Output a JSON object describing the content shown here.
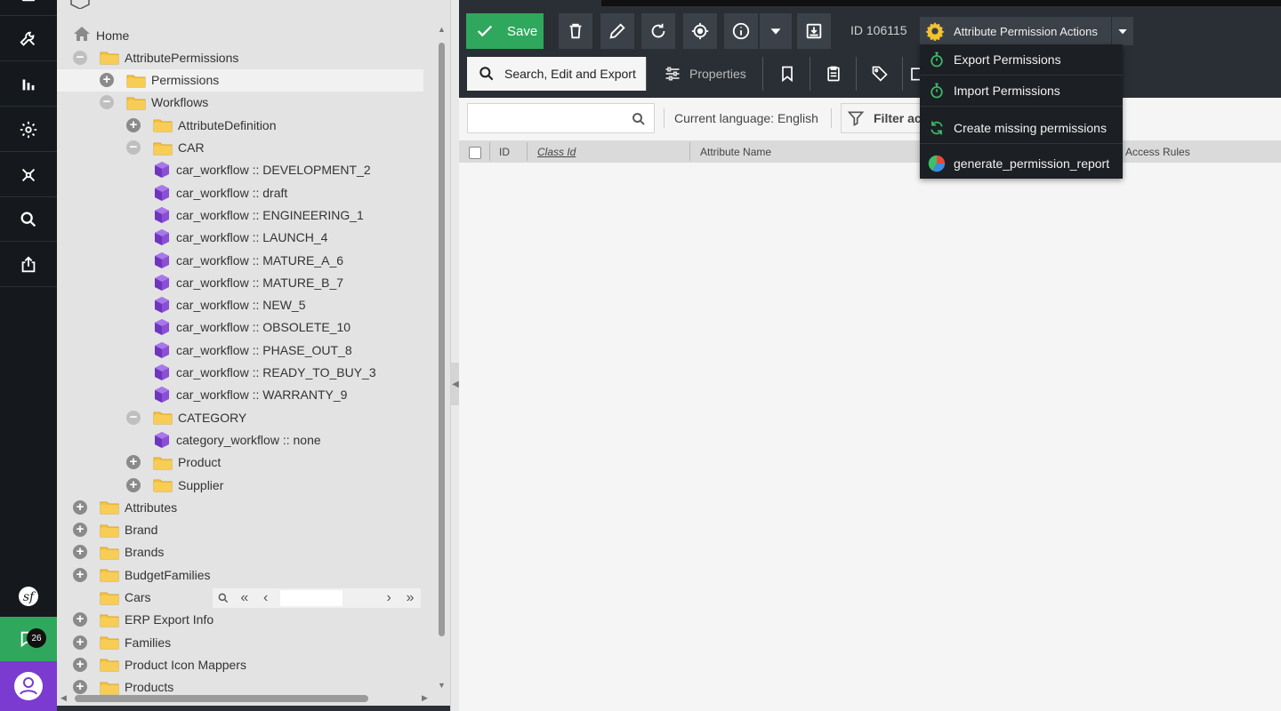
{
  "rail": {
    "icons": [
      "file-icon",
      "wrench-icon",
      "bar-chart-icon",
      "gear-icon",
      "network-icon",
      "search-icon",
      "export-icon",
      "symfony-icon",
      "chat-icon",
      "user-icon"
    ],
    "chat_count": "26"
  },
  "tree": {
    "rows": [
      {
        "label": "Home",
        "kind": "home",
        "exp": "none"
      },
      {
        "label": "AttributePermissions",
        "kind": "folder",
        "exp": "open"
      },
      {
        "label": "Permissions",
        "kind": "folder",
        "exp": "closed",
        "selected": true
      },
      {
        "label": "Workflows",
        "kind": "folder",
        "exp": "open"
      },
      {
        "label": "AttributeDefinition",
        "kind": "folder",
        "exp": "closed"
      },
      {
        "label": "CAR",
        "kind": "folder",
        "exp": "open"
      },
      {
        "label": "car_workflow :: DEVELOPMENT_2",
        "kind": "cube",
        "exp": "none"
      },
      {
        "label": "car_workflow :: draft",
        "kind": "cube",
        "exp": "none"
      },
      {
        "label": "car_workflow :: ENGINEERING_1",
        "kind": "cube",
        "exp": "none"
      },
      {
        "label": "car_workflow :: LAUNCH_4",
        "kind": "cube",
        "exp": "none"
      },
      {
        "label": "car_workflow :: MATURE_A_6",
        "kind": "cube",
        "exp": "none"
      },
      {
        "label": "car_workflow :: MATURE_B_7",
        "kind": "cube",
        "exp": "none"
      },
      {
        "label": "car_workflow :: NEW_5",
        "kind": "cube",
        "exp": "none"
      },
      {
        "label": "car_workflow :: OBSOLETE_10",
        "kind": "cube",
        "exp": "none"
      },
      {
        "label": "car_workflow :: PHASE_OUT_8",
        "kind": "cube",
        "exp": "none"
      },
      {
        "label": "car_workflow :: READY_TO_BUY_3",
        "kind": "cube",
        "exp": "none"
      },
      {
        "label": "car_workflow :: WARRANTY_9",
        "kind": "cube",
        "exp": "none"
      },
      {
        "label": "CATEGORY",
        "kind": "folder",
        "exp": "open"
      },
      {
        "label": "category_workflow :: none",
        "kind": "cube",
        "exp": "none"
      },
      {
        "label": "Product",
        "kind": "folder",
        "exp": "closed"
      },
      {
        "label": "Supplier",
        "kind": "folder",
        "exp": "closed"
      },
      {
        "label": "Attributes",
        "kind": "folder",
        "exp": "closed"
      },
      {
        "label": "Brand",
        "kind": "folder",
        "exp": "closed"
      },
      {
        "label": "Brands",
        "kind": "folder",
        "exp": "closed"
      },
      {
        "label": "BudgetFamilies",
        "kind": "folder",
        "exp": "closed"
      },
      {
        "label": "Cars",
        "kind": "folder",
        "exp": "none"
      },
      {
        "label": "ERP Export Info",
        "kind": "folder",
        "exp": "closed"
      },
      {
        "label": "Families",
        "kind": "folder",
        "exp": "closed"
      },
      {
        "label": "Product Icon Mappers",
        "kind": "folder",
        "exp": "closed"
      },
      {
        "label": "Products",
        "kind": "folder",
        "exp": "closed"
      }
    ]
  },
  "toolbar": {
    "save_label": "Save",
    "object_id": "ID 106115",
    "actions_label": "Attribute Permission Actions"
  },
  "tabs": [
    {
      "label": "Search, Edit and Export",
      "icon": "search-icon",
      "active": true
    },
    {
      "label": "Properties",
      "icon": "sliders-icon",
      "active": false
    },
    {
      "label": "",
      "icon": "bookmark-icon",
      "active": false
    },
    {
      "label": "",
      "icon": "clipboard-icon",
      "active": false
    },
    {
      "label": "",
      "icon": "tag-icon",
      "active": false
    }
  ],
  "menu": {
    "items": [
      {
        "label": "Export Permissions",
        "icon": "stopwatch-icon"
      },
      {
        "label": "Import Permissions",
        "icon": "stopwatch-icon"
      },
      {
        "label": "Create missing permissions",
        "icon": "refresh-icon"
      },
      {
        "label": "generate_permission_report",
        "icon": "pie-chart-icon"
      }
    ]
  },
  "filter_bar": {
    "search_placeholder": "",
    "language": "Current language: English",
    "filter_label": "Filter ac"
  },
  "grid": {
    "columns": [
      "ID",
      "Class Id",
      "Attribute Name",
      "Access Rules"
    ]
  },
  "colors": {
    "accent_green": "#2fa85d",
    "accent_purple": "#7b3bd0",
    "folder_yellow": "#f6c344",
    "cube_purple": "#8a4fd6",
    "dark_bg": "#2a2f35"
  }
}
